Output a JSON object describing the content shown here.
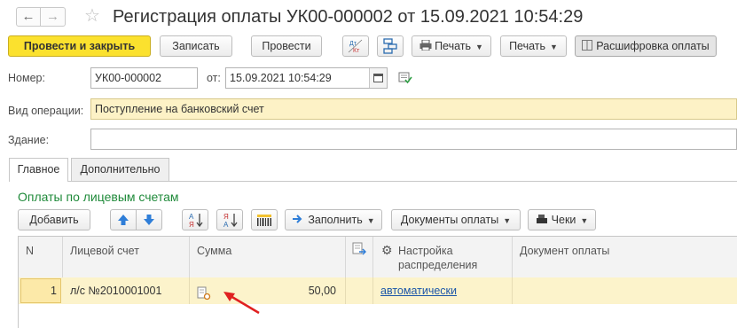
{
  "window": {
    "title": "Регистрация оплаты УК00-000002 от 15.09.2021 10:54:29"
  },
  "toolbar": {
    "post_close": "Провести и закрыть",
    "save": "Записать",
    "post": "Провести",
    "print1": "Печать",
    "print2": "Печать",
    "breakdown": "Расшифровка оплаты"
  },
  "form": {
    "number_label": "Номер:",
    "number_value": "УК00-000002",
    "from_label": "от:",
    "date_value": "15.09.2021 10:54:29",
    "operation_label": "Вид операции:",
    "operation_value": "Поступление на банковский счет",
    "building_label": "Здание:",
    "building_value": ""
  },
  "tabs": [
    {
      "label": "Главное",
      "active": true
    },
    {
      "label": "Дополнительно",
      "active": false
    }
  ],
  "section_title": "Оплаты по лицевым счетам",
  "table_toolbar": {
    "add": "Добавить",
    "fill": "Заполнить",
    "payment_docs": "Документы оплаты",
    "receipts": "Чеки"
  },
  "table": {
    "headers": {
      "n": "N",
      "account": "Лицевой счет",
      "sum": "Сумма",
      "settings": "Настройка распределения",
      "doc": "Документ оплаты"
    },
    "rows": [
      {
        "n": "1",
        "account": "л/с №2010001001",
        "sum": "50,00",
        "settings": "автоматически",
        "doc": ""
      }
    ]
  },
  "colors": {
    "primary_button": "#fbe12e",
    "section_title": "#1f8a3a",
    "highlight_row": "#fcf3cb",
    "link": "#1c56a8",
    "annotation_arrow": "#e02020"
  }
}
